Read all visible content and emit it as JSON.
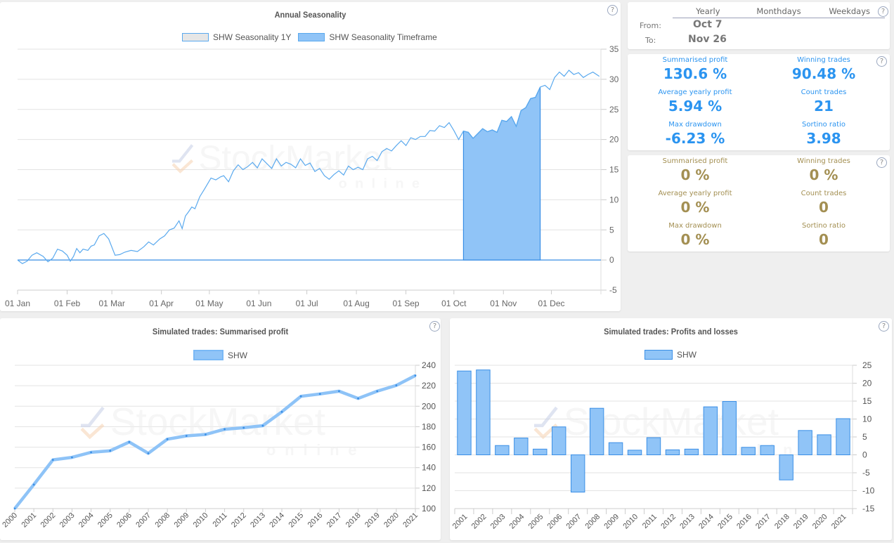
{
  "colors": {
    "accent_blue": "#2b94f0",
    "gold": "#a38f52",
    "line_blue": "#5aa9ee",
    "fill_blue": "#90c4f7",
    "bar_border": "#3a8fe6"
  },
  "help_icon": "?",
  "timeframe": {
    "tabs": [
      "Yearly",
      "Monthdays",
      "Weekdays"
    ],
    "from_label": "From:",
    "from_value": "Oct 7",
    "to_label": "To:",
    "to_value": "Nov 26"
  },
  "stats_primary": {
    "items": [
      {
        "label": "Summarised profit",
        "value": "130.6 %"
      },
      {
        "label": "Winning trades",
        "value": "90.48 %"
      },
      {
        "label": "Average yearly profit",
        "value": "5.94 %"
      },
      {
        "label": "Count trades",
        "value": "21"
      },
      {
        "label": "Max drawdown",
        "value": "-6.23 %"
      },
      {
        "label": "Sortino ratio",
        "value": "3.98"
      }
    ]
  },
  "stats_secondary": {
    "items": [
      {
        "label": "Summarised profit",
        "value": "0 %"
      },
      {
        "label": "Winning trades",
        "value": "0 %"
      },
      {
        "label": "Average yearly profit",
        "value": "0 %"
      },
      {
        "label": "Count trades",
        "value": "0"
      },
      {
        "label": "Max drawdown",
        "value": "0 %"
      },
      {
        "label": "Sortino ratio",
        "value": "0"
      }
    ]
  },
  "watermark": {
    "main": "StockMarket",
    "sub": "online"
  },
  "chart_data": [
    {
      "type": "area",
      "title": "Annual Seasonality",
      "xlabel": "",
      "ylabel": "",
      "legend": [
        "SHW Seasonality 1Y",
        "SHW Seasonality Timeframe"
      ],
      "legend_position": "top-center",
      "ylim": [
        -5,
        35
      ],
      "yticks": [
        35,
        30,
        25,
        20,
        15,
        10,
        5,
        0,
        -5
      ],
      "xticks": [
        "01 Jan",
        "01 Feb",
        "01 Mar",
        "01 Apr",
        "01 May",
        "01 Jun",
        "01 Jul",
        "01 Aug",
        "01 Sep",
        "01 Oct",
        "01 Nov",
        "01 Dec"
      ],
      "grid": true,
      "series": [
        {
          "name": "SHW Seasonality 1Y",
          "x_day_of_year": [
            1,
            4,
            7,
            10,
            13,
            17,
            20,
            23,
            26,
            29,
            32,
            34,
            36,
            38,
            40,
            42,
            45,
            47,
            49,
            52,
            55,
            58,
            62,
            65,
            68,
            72,
            76,
            80,
            83,
            86,
            90,
            93,
            96,
            99,
            102,
            104,
            106,
            108,
            110,
            112,
            115,
            118,
            122,
            125,
            128,
            130,
            133,
            136,
            139,
            142,
            145,
            148,
            151,
            154,
            157,
            160,
            163,
            166,
            169,
            172,
            175,
            178,
            181,
            184,
            187,
            190,
            193,
            196,
            199,
            202,
            205,
            208,
            211,
            214,
            217,
            220,
            223,
            226,
            229,
            232,
            235,
            238,
            241,
            244,
            247,
            250,
            253,
            256,
            259,
            262,
            265,
            268,
            271,
            274,
            277,
            280,
            283,
            286,
            289,
            292,
            295,
            298,
            301,
            304,
            307,
            310,
            313,
            316,
            319,
            322,
            325,
            328,
            331,
            334,
            337,
            340,
            343,
            346,
            349,
            352,
            355,
            358,
            361,
            365
          ],
          "values": [
            0,
            -0.6,
            -0.2,
            0.8,
            1.2,
            0.6,
            -0.3,
            0.3,
            1.8,
            1.5,
            0.8,
            -0.2,
            0.6,
            1.9,
            1.2,
            1.8,
            1.6,
            2.3,
            2.5,
            4.0,
            4.4,
            3.5,
            0.8,
            0.9,
            1.3,
            1.6,
            1.4,
            2.2,
            3.0,
            2.5,
            3.5,
            4.0,
            5.0,
            5.3,
            6.5,
            5.2,
            7.3,
            8.0,
            8.8,
            8.5,
            10.5,
            11.8,
            13.6,
            13.3,
            13.8,
            14.0,
            13.0,
            14.8,
            15.8,
            15.0,
            15.5,
            16.2,
            15.3,
            16.8,
            16.0,
            15.2,
            16.8,
            15.6,
            16.2,
            15.9,
            15.3,
            16.8,
            15.7,
            16.1,
            14.7,
            15.2,
            14.0,
            13.4,
            14.2,
            14.8,
            14.1,
            15.6,
            15.0,
            15.4,
            15.0,
            16.8,
            17.2,
            16.5,
            18.0,
            18.5,
            18.1,
            19.0,
            19.8,
            19.0,
            20.3,
            20.0,
            20.5,
            20.5,
            21.5,
            21.4,
            22.3,
            22.0,
            22.8,
            21.5,
            20.0,
            21.4,
            21.2,
            20.2,
            21.0,
            21.8,
            21.3,
            21.6,
            21.2,
            23.2,
            23.0,
            23.8,
            22.2,
            24.8,
            25.3,
            26.8,
            27.0,
            28.7,
            29.0,
            28.3,
            30.3,
            31.2,
            30.5,
            31.5,
            30.8,
            31.1,
            30.3,
            30.8,
            31.2,
            30.5,
            32.0,
            32.2,
            33.0,
            33.5
          ],
          "color": "#5aa9ee"
        },
        {
          "name": "SHW Seasonality Timeframe",
          "range_day_of_year": [
            280,
            330
          ],
          "values_note": "follows 1Y series within Oct 7 – Nov 26, zero elsewhere",
          "color": "#90c4f7"
        }
      ]
    },
    {
      "type": "line",
      "title": "Simulated trades: Summarised profit",
      "legend": [
        "SHW"
      ],
      "legend_position": "top-center",
      "categories": [
        "2000",
        "2001",
        "2002",
        "2003",
        "2004",
        "2005",
        "2006",
        "2007",
        "2008",
        "2009",
        "2010",
        "2011",
        "2012",
        "2013",
        "2014",
        "2015",
        "2016",
        "2017",
        "2018",
        "2019",
        "2020",
        "2021"
      ],
      "series": [
        {
          "name": "SHW",
          "values": [
            100,
            123.4,
            147.6,
            150,
            155,
            156.5,
            165,
            154,
            167.8,
            171,
            172.4,
            177.5,
            179,
            181,
            194.5,
            209.7,
            212,
            214.7,
            207.6,
            214.7,
            220.4,
            230
          ]
        }
      ],
      "ylim": [
        100,
        240
      ],
      "yticks": [
        240,
        220,
        200,
        180,
        160,
        140,
        120,
        100
      ],
      "grid": true
    },
    {
      "type": "bar",
      "title": "Simulated trades: Profits and losses",
      "legend": [
        "SHW"
      ],
      "legend_position": "top-center",
      "categories": [
        "2001",
        "2002",
        "2003",
        "2004",
        "2005",
        "2006",
        "2007",
        "2008",
        "2009",
        "2010",
        "2011",
        "2012",
        "2013",
        "2014",
        "2015",
        "2016",
        "2017",
        "2018",
        "2019",
        "2020",
        "2021"
      ],
      "series": [
        {
          "name": "SHW",
          "values": [
            23.4,
            23.7,
            2.6,
            4.7,
            1.6,
            7.8,
            -10.4,
            13.0,
            3.4,
            1.3,
            4.8,
            1.4,
            1.6,
            13.4,
            14.9,
            2.1,
            2.6,
            -7.0,
            6.8,
            5.6,
            10.1
          ]
        }
      ],
      "ylim": [
        -15,
        25
      ],
      "yticks": [
        25,
        20,
        15,
        10,
        5,
        0,
        -5,
        -10,
        -15
      ],
      "grid": true
    }
  ]
}
